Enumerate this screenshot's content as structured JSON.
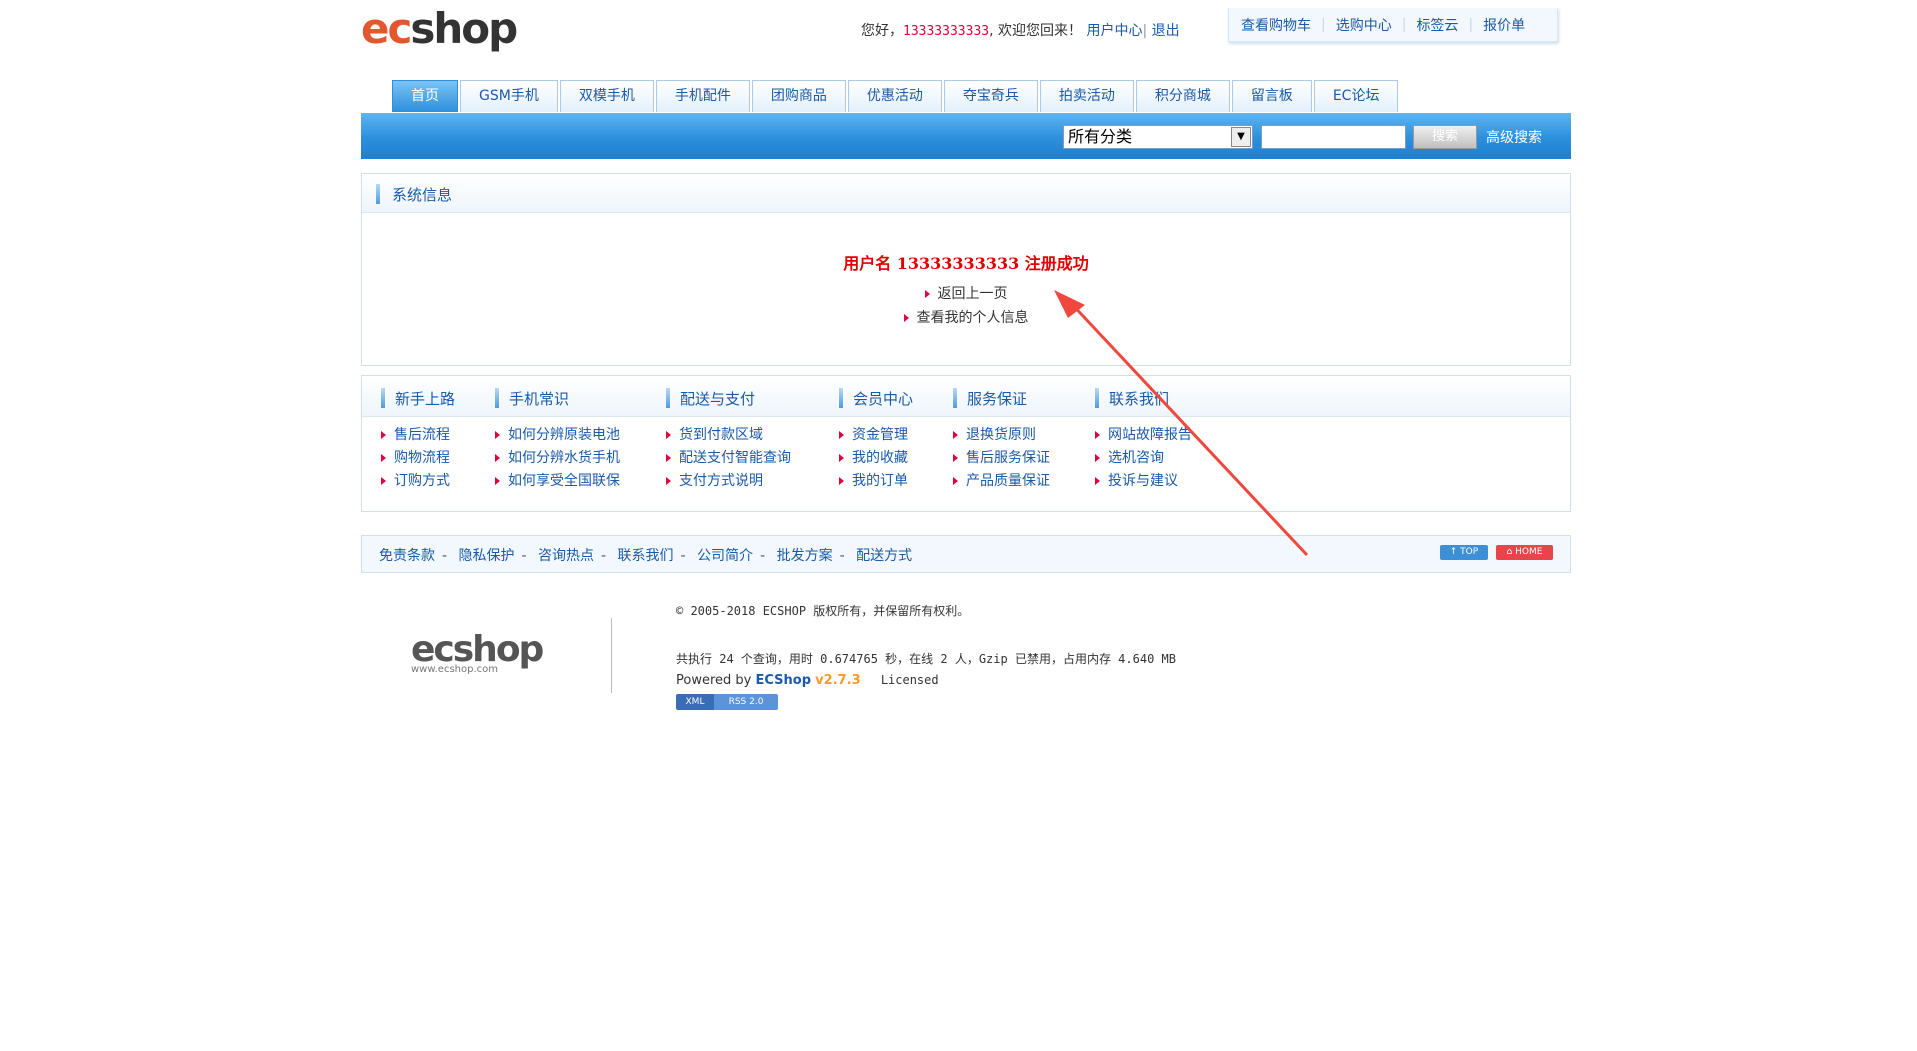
{
  "header": {
    "logo_ec": "ec",
    "logo_shop": "shop",
    "greeting": "您好，",
    "username": "13333333333",
    "welcome_back": ", 欢迎您回来！",
    "user_center": "用户中心",
    "divider": "|",
    "logout": "退出",
    "top_links": [
      "查看购物车",
      "选购中心",
      "标签云",
      "报价单"
    ]
  },
  "nav": {
    "tabs": [
      "首页",
      "GSM手机",
      "双模手机",
      "手机配件",
      "团购商品",
      "优惠活动",
      "夺宝奇兵",
      "拍卖活动",
      "积分商城",
      "留言板",
      "EC论坛"
    ],
    "active_index": 0
  },
  "search": {
    "category": "所有分类",
    "keyword": "",
    "button": "搜索",
    "advanced": "高级搜索"
  },
  "system_message": {
    "title": "系统信息",
    "message": "用户名 13333333333 注册成功",
    "links": [
      "返回上一页",
      "查看我的个人信息"
    ]
  },
  "help": [
    {
      "title": "新手上路",
      "items": [
        "售后流程",
        "购物流程",
        "订购方式"
      ]
    },
    {
      "title": "手机常识",
      "items": [
        "如何分辨原装电池",
        "如何分辨水货手机",
        "如何享受全国联保"
      ]
    },
    {
      "title": "配送与支付",
      "items": [
        "货到付款区域",
        "配送支付智能查询",
        "支付方式说明"
      ]
    },
    {
      "title": "会员中心",
      "items": [
        "资金管理",
        "我的收藏",
        "我的订单"
      ]
    },
    {
      "title": "服务保证",
      "items": [
        "退换货原则",
        "售后服务保证",
        "产品质量保证"
      ]
    },
    {
      "title": "联系我们",
      "items": [
        "网站故障报告",
        "选机咨询",
        "投诉与建议"
      ]
    }
  ],
  "footer_nav": {
    "links": [
      "免责条款",
      "隐私保护",
      "咨询热点",
      "联系我们",
      "公司简介",
      "批发方案",
      "配送方式"
    ],
    "separator": "-",
    "top_button": "↑ TOP",
    "home_button": "⌂ HOME"
  },
  "copyright": {
    "logo_text": "ecshop",
    "logo_url": "www.ecshop.com",
    "line1": "© 2005-2018 ECSHOP 版权所有，并保留所有权利。",
    "line2": "共执行 24 个查询，用时 0.674765 秒，在线 2 人，Gzip 已禁用，占用内存 4.640 MB",
    "powered_by": "Powered by",
    "brand": "ECShop",
    "version": "v2.7.3",
    "licensed": "Licensed",
    "badge_xml": "XML",
    "badge_rss": "RSS 2.0"
  },
  "colors": {
    "accent_blue": "#2c8fdc",
    "link_blue": "#1a5aa8",
    "alert_red": "#e00000",
    "annotation_arrow": "#f0473e"
  }
}
